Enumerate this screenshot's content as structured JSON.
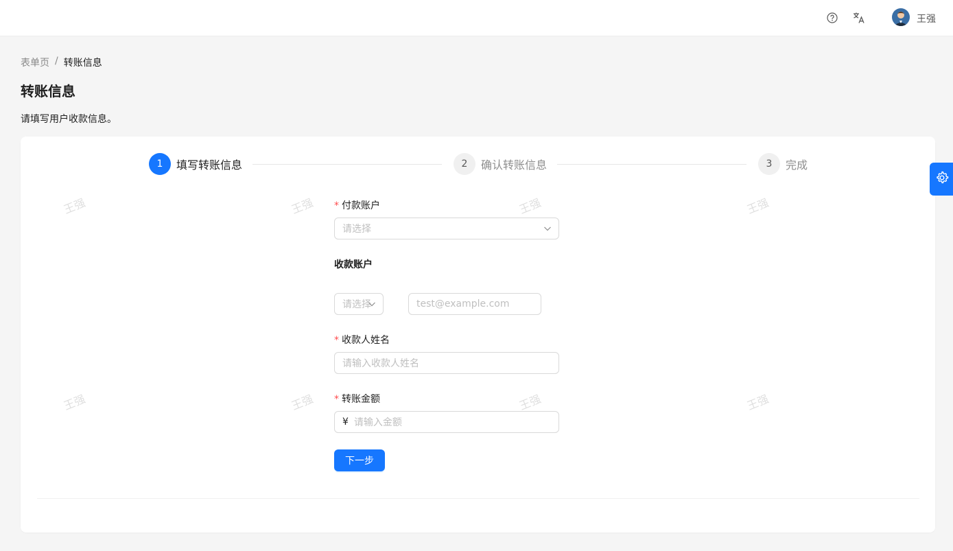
{
  "header": {
    "icons": [
      "help-icon",
      "translate-icon"
    ],
    "user_name": "王强"
  },
  "breadcrumb": {
    "items": [
      "表单页",
      "转账信息"
    ],
    "separator": "/"
  },
  "page": {
    "title": "转账信息",
    "description": "请填写用户收款信息。"
  },
  "steps": [
    {
      "num": "1",
      "label": "填写转账信息",
      "status": "active"
    },
    {
      "num": "2",
      "label": "确认转账信息",
      "status": "wait"
    },
    {
      "num": "3",
      "label": "完成",
      "status": "wait"
    }
  ],
  "form": {
    "pay_account": {
      "label": "付款账户",
      "placeholder": "请选择",
      "required": true
    },
    "receive_account": {
      "label": "收款账户",
      "type_placeholder": "请选择",
      "account_placeholder": "test@example.com"
    },
    "receiver_name": {
      "label": "收款人姓名",
      "placeholder": "请输入收款人姓名",
      "required": true
    },
    "amount": {
      "label": "转账金额",
      "prefix": "¥",
      "placeholder": "请输入金额",
      "required": true
    },
    "next_label": "下一步"
  },
  "watermark": {
    "text": "王强"
  },
  "colors": {
    "primary": "#1677ff",
    "required": "#ff4d4f"
  }
}
